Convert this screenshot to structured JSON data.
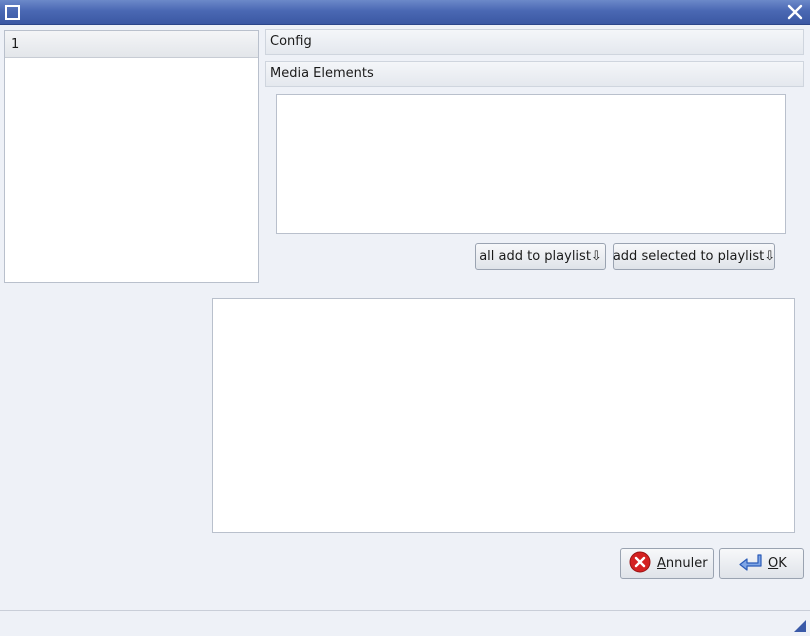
{
  "window": {
    "close_glyph": "✕",
    "icons": {
      "menu": "window-menu-icon",
      "close": "close-icon"
    }
  },
  "list": {
    "items": [
      {
        "label": "1"
      }
    ]
  },
  "sections": {
    "config_label": "Config",
    "media_label": "Media Elements"
  },
  "buttons": {
    "all_add": "all add to playlist⇩",
    "add_selected": "add selected to playlist⇩",
    "cancel_prefix": "",
    "cancel_mnemonic": "A",
    "cancel_rest": "nnuler",
    "ok_mnemonic": "O",
    "ok_rest": "K"
  },
  "colors": {
    "titlebar": "#4a68b3",
    "background": "#eef1f7",
    "cancel_icon": "#d42121",
    "ok_icon": "#2a5bb8"
  }
}
